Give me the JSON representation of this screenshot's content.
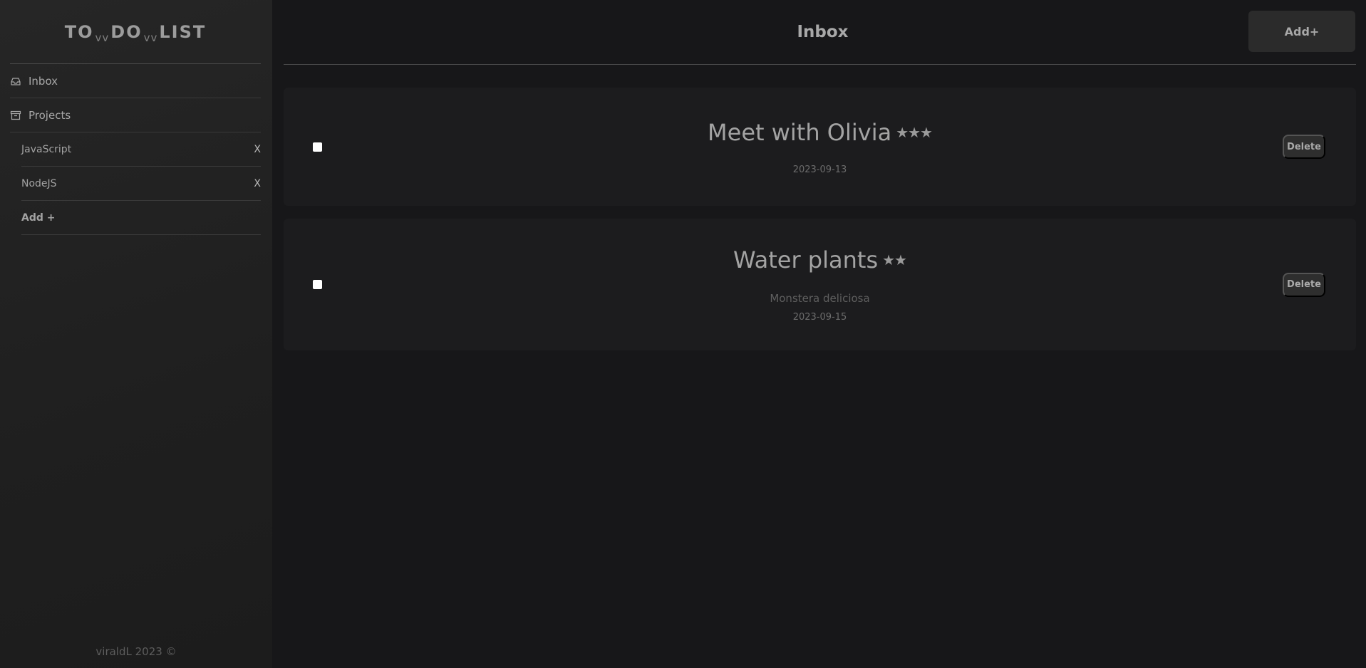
{
  "logo": {
    "part1": "TO",
    "sep1": "vv",
    "part2": "DO",
    "sep2": "vv",
    "part3": "LIST"
  },
  "sidebar": {
    "inbox_label": "Inbox",
    "projects_label": "Projects",
    "projects": [
      {
        "name": "JavaScript",
        "delete": "X"
      },
      {
        "name": "NodeJS",
        "delete": "X"
      }
    ],
    "add_project": "Add +",
    "footer": "viraldL 2023 ©"
  },
  "header": {
    "title": "Inbox",
    "add_button": "Add+"
  },
  "tasks": [
    {
      "title": "Meet with Olivia",
      "stars": "★★★",
      "description": "",
      "date": "2023-09-13",
      "delete": "Delete"
    },
    {
      "title": "Water plants",
      "stars": "★★",
      "description": "Monstera deliciosa",
      "date": "2023-09-15",
      "delete": "Delete"
    }
  ]
}
